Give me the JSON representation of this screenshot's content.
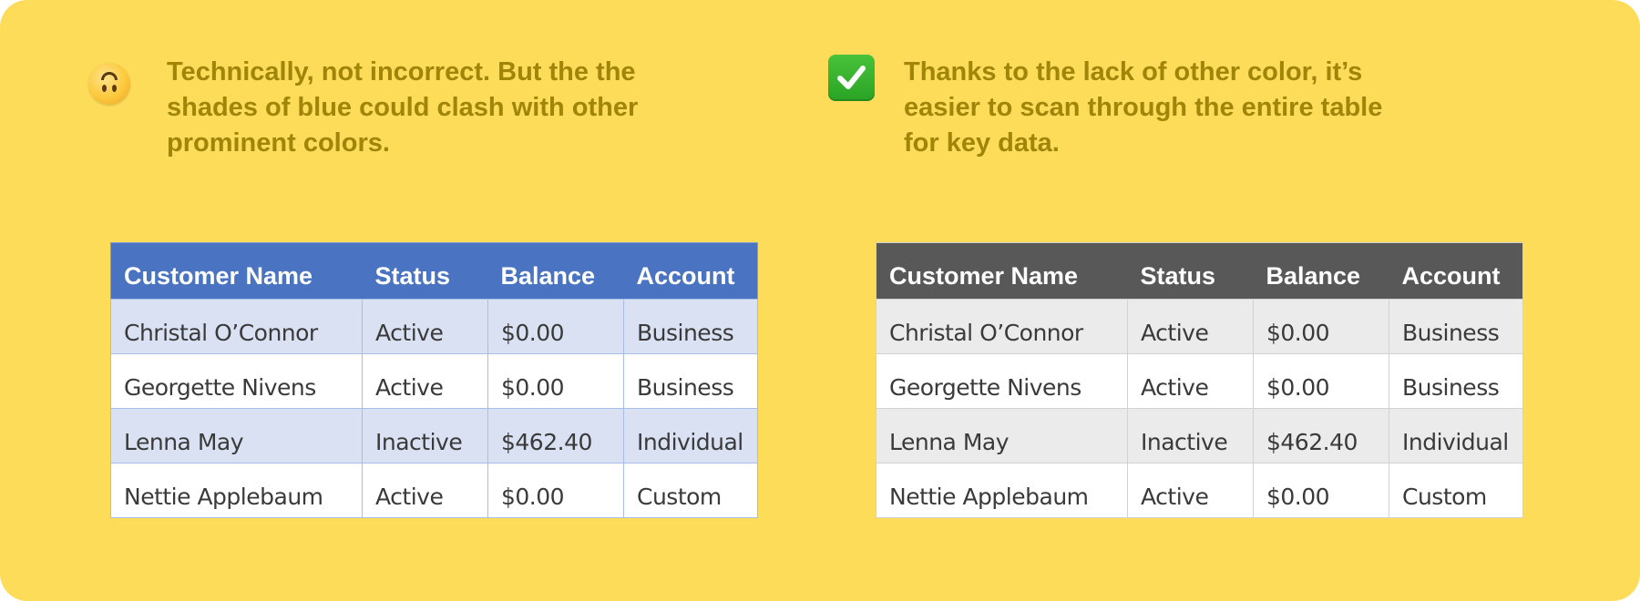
{
  "colors": {
    "background": "#fddc5a",
    "caption_text": "#a08509",
    "blue_header": "#4a74c1",
    "blue_band": "#d9e1f3",
    "gray_header": "#585858",
    "gray_band": "#ebebeb",
    "overdue_red": "#e11d17"
  },
  "left": {
    "icon": "upside-down-face-emoji",
    "caption": "Technically, not incorrect. But the the shades of blue could clash with other prominent colors."
  },
  "right": {
    "icon": "check-mark-button-emoji",
    "caption": "Thanks to the lack of other color, it’s easier to scan through the entire table for key data."
  },
  "table": {
    "headers": [
      "Customer Name",
      "Status",
      "Balance",
      "Account"
    ],
    "rows": [
      [
        "Christal O’Connor",
        "Active",
        "$0.00",
        "Business"
      ],
      [
        "Georgette Nivens",
        "Active",
        "$0.00",
        "Business"
      ],
      [
        "Lenna May",
        "Inactive",
        "$462.40",
        "Individual"
      ],
      [
        "Nettie Applebaum",
        "Active",
        "$0.00",
        "Custom"
      ]
    ]
  }
}
